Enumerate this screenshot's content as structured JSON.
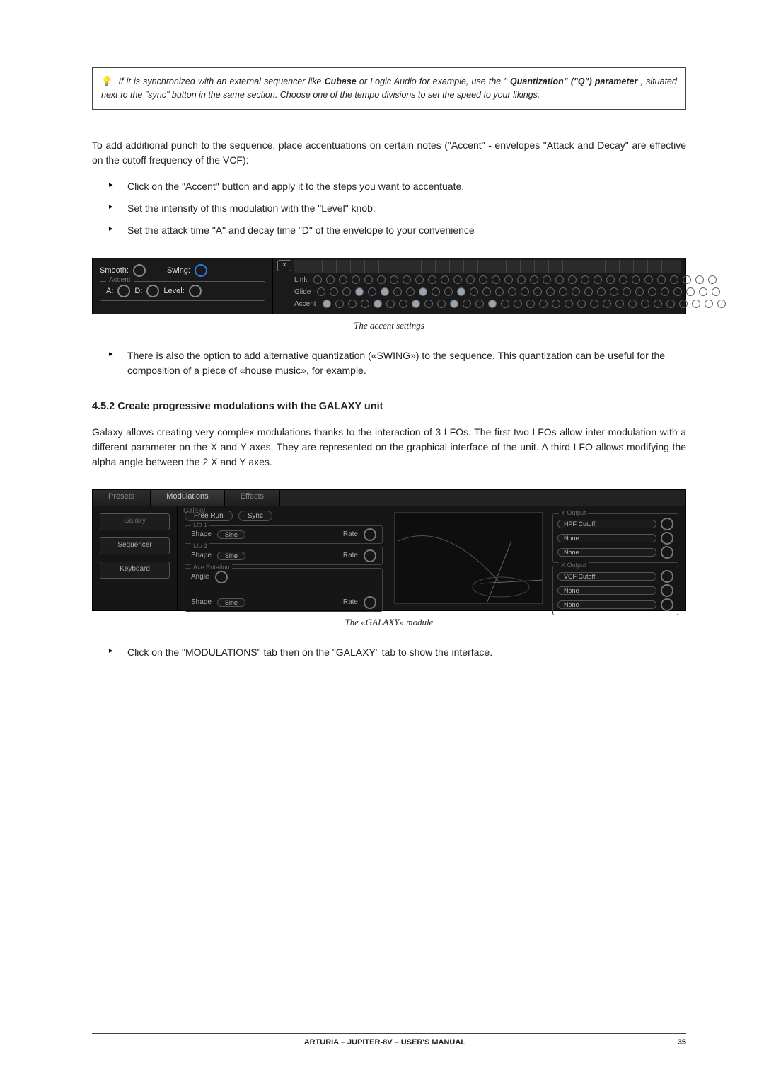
{
  "tip": {
    "pre": "If it is synchronized with an external sequencer like ",
    "b1": "Cubase",
    "mid": " or Logic Audio for example, use the \"",
    "b2": "Quantization\" (\"Q\") parameter",
    "post": ", situated next to the \"sync\" button in the same section. Choose one of the tempo divisions to set the speed to your likings."
  },
  "para_intro": "To add additional punch to the sequence, place accentuations on certain notes (\"Accent\" - envelopes \"Attack and Decay\" are effective on the cutoff frequency of the VCF):",
  "list1": [
    "Click on the \"Accent\" button and apply it to the steps you want to accentuate.",
    "Set the intensity of this modulation with the \"Level\" knob.",
    "Set the attack time \"A\" and decay time \"D\" of the envelope to your convenience"
  ],
  "fig1": {
    "smooth": "Smooth:",
    "swing": "Swing:",
    "frame_title": "Accent",
    "a": "A:",
    "d": "D:",
    "level": "Level:",
    "x": "×",
    "row_labels": [
      "Link",
      "Glide",
      "Accent"
    ],
    "glide_on": [
      3,
      5,
      8,
      11
    ],
    "accent_on": [
      0,
      4,
      7,
      10,
      13
    ],
    "caption": "The accent settings"
  },
  "para_swing": "There is also the option to add alternative quantization («SWING») to the sequence. This quantization can be useful for the composition of a piece of «house music», for example.",
  "sec_title": "4.5.2  Create progressive modulations with the GALAXY unit",
  "para_galaxy": "Galaxy allows creating very complex modulations thanks to the interaction of 3 LFOs. The first two LFOs allow inter-modulation with a different parameter on the X and Y axes. They are represented on the graphical interface of the unit. A third LFO allows modifying the alpha angle between the 2 X and Y axes.",
  "fig2": {
    "galaxy_label": "Galaxy",
    "tabs": [
      "Presets",
      "Modulations",
      "Effects"
    ],
    "side": [
      "Galaxy",
      "Sequencer",
      "Keyboard"
    ],
    "mode": [
      "Free Run",
      "Sync"
    ],
    "box1": {
      "title": "Lfo 1",
      "shape": "Shape",
      "sel": "Sine",
      "rate": "Rate"
    },
    "box2": {
      "title": "Lfo 2",
      "shape": "Shape",
      "sel": "Sine",
      "rate": "Rate"
    },
    "box3": {
      "title": "Axe Rotation",
      "angle": "Angle",
      "shape": "Shape",
      "sel": "Sine",
      "rate": "Rate"
    },
    "yout": {
      "title": "Y Output",
      "items": [
        "HPF Cutoff",
        "None",
        "None"
      ]
    },
    "xout": {
      "title": "X Output",
      "items": [
        "VCF Cutoff",
        "None",
        "None"
      ]
    },
    "caption": "The «GALAXY» module"
  },
  "list2": [
    "Click on the \"MODULATIONS\" tab then on the \"GALAXY\" tab to show the interface."
  ],
  "footer": {
    "center": "ARTURIA – JUPITER-8V – USER'S MANUAL",
    "page": "35"
  }
}
